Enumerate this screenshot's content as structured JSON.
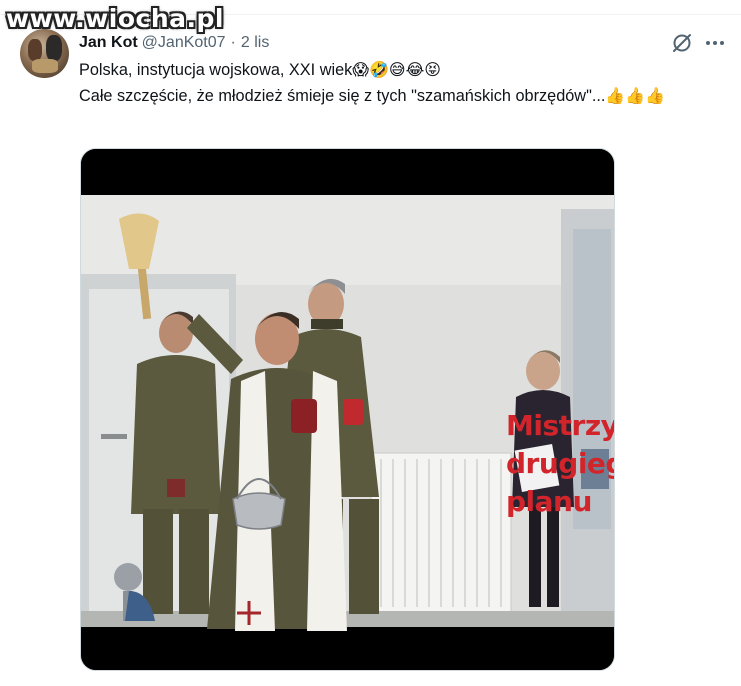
{
  "watermark": "www.wiocha.pl",
  "tweet": {
    "author_name": "Jan Kot",
    "handle": "@JanKot07",
    "separator": "·",
    "time": "2 lis",
    "line1_text": "Polska, instytucja wojskowa, XXI wiek",
    "line1_emojis": "😱🤣😅😂😝",
    "line2_text": "Całe szczęście, że młodzież śmieje się z tych \"szamańskich obrzędów\"...",
    "line2_emojis": "👍👍👍"
  },
  "media": {
    "caption_line1": "Mistrzyni",
    "caption_line2": "drugiego",
    "caption_line3": "planu"
  },
  "icons": {
    "grok": "grok-icon",
    "more": "more-horizontal-icon"
  },
  "colors": {
    "text_primary": "#0f1419",
    "text_secondary": "#536471",
    "caption_red": "#d2242b",
    "uniform_olive": "#5b5a3e"
  }
}
